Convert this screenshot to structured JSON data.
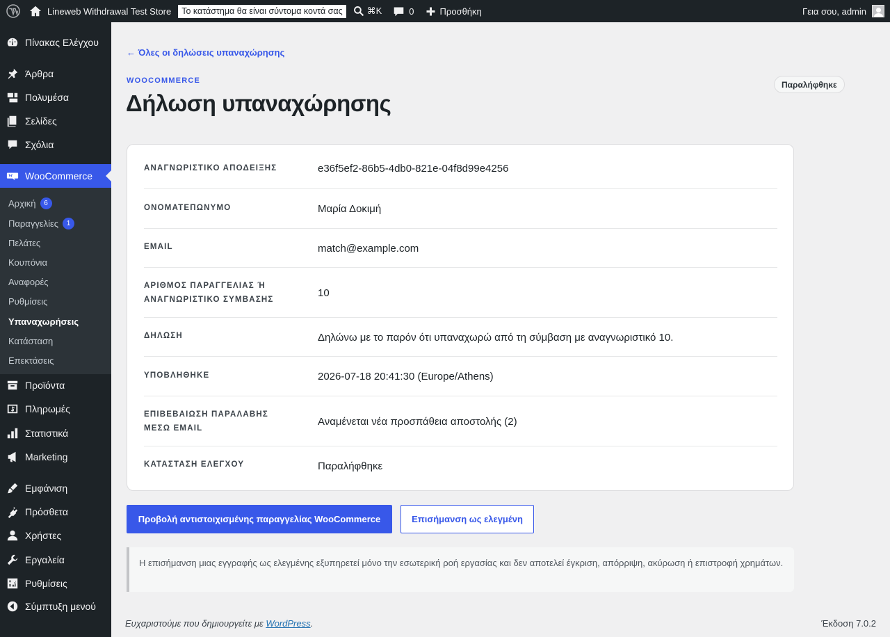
{
  "adminbar": {
    "site_name": "Lineweb Withdrawal Test Store",
    "notice": "Το κατάστημα θα είναι σύντομα κοντά σας",
    "search_shortcut": "⌘K",
    "comments_count": "0",
    "new_label": "Προσθήκη",
    "greeting": "Γεια σου, admin"
  },
  "sidebar": {
    "items": [
      {
        "label": "Πίνακας Ελέγχου",
        "icon": "dashboard-icon"
      },
      {
        "label": "Άρθρα",
        "icon": "pin-icon"
      },
      {
        "label": "Πολυμέσα",
        "icon": "media-icon"
      },
      {
        "label": "Σελίδες",
        "icon": "pages-icon"
      },
      {
        "label": "Σχόλια",
        "icon": "comments-icon"
      },
      {
        "label": "WooCommerce",
        "icon": "woo-icon"
      },
      {
        "label": "Προϊόντα",
        "icon": "products-icon"
      },
      {
        "label": "Πληρωμές",
        "icon": "payments-icon"
      },
      {
        "label": "Στατιστικά",
        "icon": "analytics-icon"
      },
      {
        "label": "Marketing",
        "icon": "megaphone-icon"
      },
      {
        "label": "Εμφάνιση",
        "icon": "brush-icon"
      },
      {
        "label": "Πρόσθετα",
        "icon": "plugin-icon"
      },
      {
        "label": "Χρήστες",
        "icon": "users-icon"
      },
      {
        "label": "Εργαλεία",
        "icon": "wrench-icon"
      },
      {
        "label": "Ρυθμίσεις",
        "icon": "settings-icon"
      },
      {
        "label": "Σύμπτυξη μενού",
        "icon": "collapse-icon"
      }
    ],
    "submenu": [
      {
        "label": "Αρχική",
        "badge": "6"
      },
      {
        "label": "Παραγγελίες",
        "badge": "1"
      },
      {
        "label": "Πελάτες"
      },
      {
        "label": "Κουπόνια"
      },
      {
        "label": "Αναφορές"
      },
      {
        "label": "Ρυθμίσεις"
      },
      {
        "label": "Υπαναχωρήσεις"
      },
      {
        "label": "Κατάσταση"
      },
      {
        "label": "Επεκτάσεις"
      }
    ]
  },
  "page": {
    "back_link": "← Όλες οι δηλώσεις υπαναχώρησης",
    "kicker": "WOOCOMMERCE",
    "title": "Δήλωση υπαναχώρησης",
    "status": "Παραλήφθηκε"
  },
  "details": [
    {
      "label": "ΑΝΑΓΝΩΡΙΣΤΙΚΟ ΑΠΟΔΕΙΞΗΣ",
      "value": "e36f5ef2-86b5-4db0-821e-04f8d99e4256"
    },
    {
      "label": "ΟΝΟΜΑΤΕΠΩΝΥΜΟ",
      "value": "Μαρία Δοκιμή"
    },
    {
      "label": "EMAIL",
      "value": "match@example.com"
    },
    {
      "label": "ΑΡΙΘΜΟΣ ΠΑΡΑΓΓΕΛΙΑΣ Ή ΑΝΑΓΝΩΡΙΣΤΙΚΟ ΣΥΜΒΑΣΗΣ",
      "value": "10"
    },
    {
      "label": "ΔΗΛΩΣΗ",
      "value": "Δηλώνω με το παρόν ότι υπαναχωρώ από τη σύμβαση με αναγνωριστικό 10."
    },
    {
      "label": "ΥΠΟΒΛΗΘΗΚΕ",
      "value": "2026-07-18 20:41:30 (Europe/Athens)"
    },
    {
      "label": "ΕΠΙΒΕΒΑΙΩΣΗ ΠΑΡΑΛΑΒΗΣ ΜΕΣΩ EMAIL",
      "value": "Αναμένεται νέα προσπάθεια αποστολής (2)"
    },
    {
      "label": "ΚΑΤΑΣΤΑΣΗ ΕΛΕΓΧΟΥ",
      "value": "Παραλήφθηκε"
    }
  ],
  "actions": {
    "primary": "Προβολή αντιστοιχισμένης παραγγελίας WooCommerce",
    "secondary": "Επισήμανση ως ελεγμένη"
  },
  "notice": "Η επισήμανση μιας εγγραφής ως ελεγμένης εξυπηρετεί μόνο την εσωτερική ροή εργασίας και δεν αποτελεί έγκριση, απόρριψη, ακύρωση ή επιστροφή χρημάτων.",
  "footer": {
    "thanks": "Ευχαριστούμε που δημιουργείτε με",
    "link": "WordPress",
    "version": "Έκδοση 7.0.2"
  },
  "colors": {
    "accent": "#3858e9",
    "sidebar": "#1d2327",
    "submenu": "#2c3338"
  }
}
